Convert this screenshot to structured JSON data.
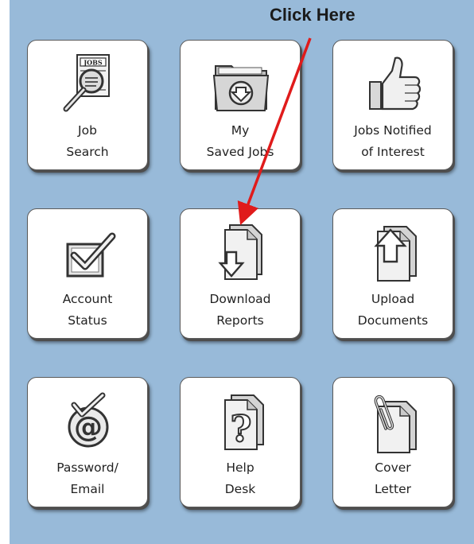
{
  "callout": "Click Here",
  "tiles": {
    "job_search": {
      "line1": "Job",
      "line2": "Search"
    },
    "saved_jobs": {
      "line1": "My",
      "line2": "Saved Jobs"
    },
    "jobs_notified": {
      "line1": "Jobs Notified",
      "line2": "of Interest"
    },
    "account_status": {
      "line1": "Account",
      "line2": "Status"
    },
    "download_reports": {
      "line1": "Download",
      "line2": "Reports"
    },
    "upload_documents": {
      "line1": "Upload",
      "line2": "Documents"
    },
    "password_email": {
      "line1": "Password/",
      "line2": "Email"
    },
    "help_desk": {
      "line1": "Help",
      "line2": "Desk"
    },
    "cover_letter": {
      "line1": "Cover",
      "line2": "Letter"
    }
  },
  "colors": {
    "background": "#98bad9",
    "arrow": "#e01b1b"
  },
  "icons": {
    "job_search": "magnifier-over-jobs-newspaper-icon",
    "saved_jobs": "folder-download-icon",
    "jobs_notified": "thumbs-up-icon",
    "account_status": "checkbox-icon",
    "download_reports": "document-download-arrow-icon",
    "upload_documents": "document-upload-arrow-icon",
    "password_email": "at-sign-check-icon",
    "help_desk": "question-mark-document-icon",
    "cover_letter": "paperclip-document-icon"
  }
}
